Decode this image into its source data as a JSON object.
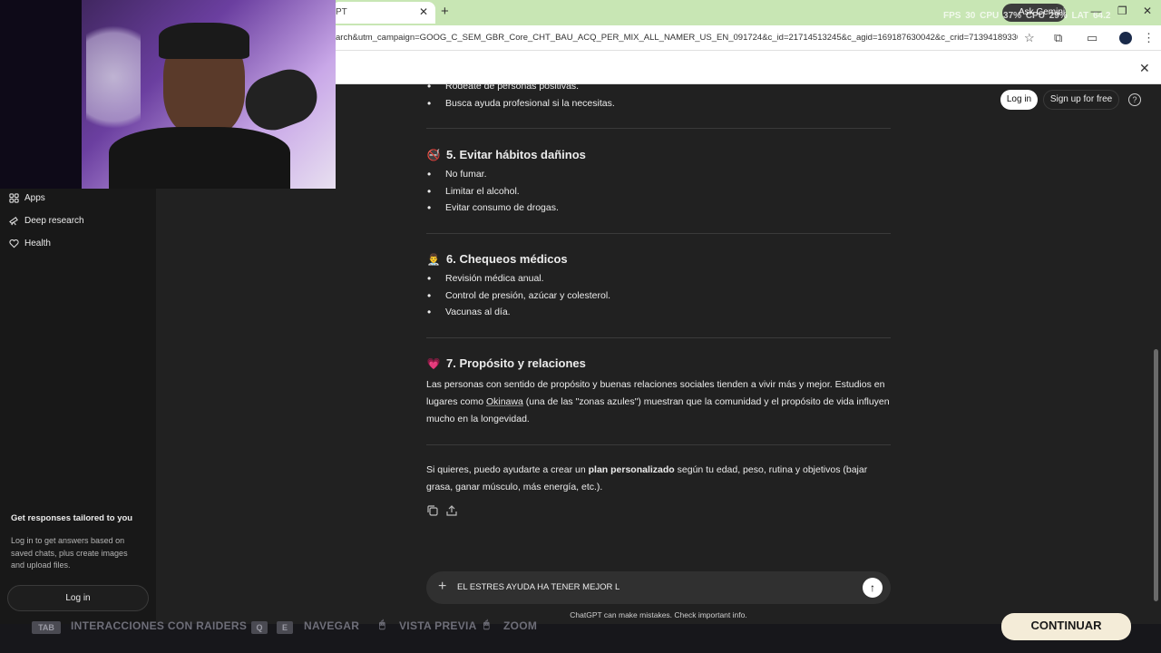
{
  "browser": {
    "tab_title": "PT",
    "url": "arch&utm_campaign=GOOG_C_SEM_GBR_Core_CHT_BAU_ACQ_PER_MIX_ALL_NAMER_US_EN_091724&c_id=21714513245&c_agid=169187630042&c_crid=713941893301&c_kwid=...",
    "ask_gemini": "Ask Gemini",
    "overlay_stats": "FPS 30  CPU 37%  CPU 29%  LAT 64.2"
  },
  "sidebar": {
    "items": [
      {
        "label": "Apps",
        "icon": "apps-icon"
      },
      {
        "label": "Deep research",
        "icon": "telescope-icon"
      },
      {
        "label": "Health",
        "icon": "heart-icon"
      }
    ],
    "promo_title": "Get responses tailored to you",
    "promo_body": "Log in to get answers based on saved chats, plus create images and upload files.",
    "login": "Log in"
  },
  "header": {
    "login": "Log in",
    "signup": "Sign up for free",
    "help": "?"
  },
  "chat": {
    "top_bullets": [
      "Rodéate de personas positivas.",
      "Busca ayuda profesional si la necesitas."
    ],
    "section5": {
      "emoji": "🚭",
      "title": "5. Evitar hábitos dañinos",
      "bullets": [
        "No fumar.",
        "Limitar el alcohol.",
        "Evitar consumo de drogas."
      ]
    },
    "section6": {
      "emoji": "👨‍⚕️",
      "title": "6. Chequeos médicos",
      "bullets": [
        "Revisión médica anual.",
        "Control de presión, azúcar y colesterol.",
        "Vacunas al día."
      ]
    },
    "section7": {
      "emoji": "💗",
      "title": "7. Propósito y relaciones",
      "para_a": "Las personas con sentido de propósito y buenas relaciones sociales tienden a vivir más y mejor. Estudios en lugares como ",
      "link": "Okinawa",
      "para_b": " (una de las \"zonas azules\") muestran que la comunidad y el propósito de vida influyen mucho en la longevidad."
    },
    "closing_a": "Si quieres, puedo ayudarte a crear un ",
    "closing_bold": "plan personalizado",
    "closing_b": " según tu edad, peso, rutina y objetivos (bajar grasa, ganar músculo, más energía, etc.)."
  },
  "composer": {
    "value": "EL ESTRES AYUDA HA TENER MEJOR L",
    "disclaimer": "ChatGPT can make mistakes. Check important info."
  },
  "gamebar": {
    "key_tab": "TAB",
    "label_raiders": "INTERACCIONES CON RAIDERS",
    "key_q": "Q",
    "key_e": "E",
    "label_navegar": "NAVEGAR",
    "label_vista": "VISTA PREVIA",
    "label_zoom": "ZOOM",
    "continue": "CONTINUAR"
  }
}
